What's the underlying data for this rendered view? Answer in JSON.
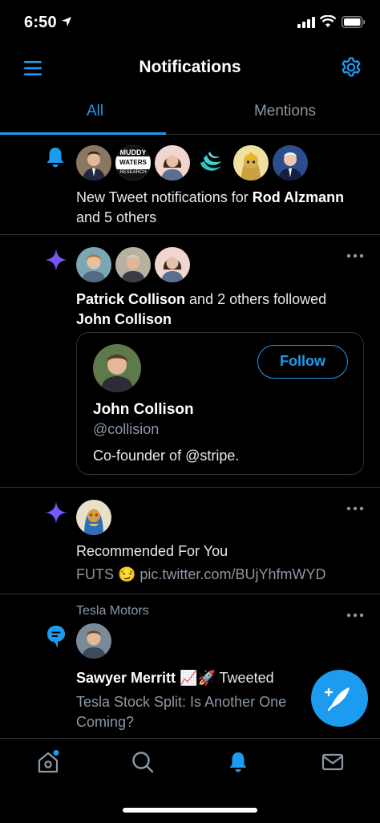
{
  "status_bar": {
    "time": "6:50"
  },
  "header": {
    "title": "Notifications"
  },
  "tabs": [
    {
      "label": "All"
    },
    {
      "label": "Mentions"
    }
  ],
  "colors": {
    "accent": "#1d9bf0",
    "purple": "#7856ff",
    "background": "#000000",
    "divider": "#2f3336",
    "muted": "#8b98a5"
  },
  "notifications": [
    {
      "icon": "bell-icon",
      "avatar_labels": {
        "muddy_line1": "MUDDY",
        "muddy_line2": "WATERS",
        "muddy_line3": "RESEARCH"
      },
      "text_prefix": "New Tweet notifications for ",
      "text_bold": "Rod Alzmann",
      "text_suffix": " and 5 others"
    },
    {
      "icon": "sparkle-icon",
      "text_bold_1": "Patrick Collison",
      "text_mid": " and 2 others followed ",
      "text_bold_2": "John Collison",
      "card": {
        "name": "John Collison",
        "handle": "@collision",
        "bio": "Co-founder of @stripe.",
        "follow_label": "Follow"
      }
    },
    {
      "icon": "sparkle-icon",
      "text": "Recommended For You",
      "sub": "FUTS 😏 pic.twitter.com/BUjYhfmWYD"
    },
    {
      "icon": "speech-bubble-icon",
      "context": "Tesla Motors",
      "text_bold": "Sawyer Merritt 📈🚀",
      "text_suffix": " Tweeted",
      "sub": "Tesla Stock Split: Is Another One Coming?"
    }
  ],
  "tab_bar": [
    {
      "icon": "home-icon",
      "has_dot": true
    },
    {
      "icon": "search-icon"
    },
    {
      "icon": "bell-icon",
      "active": true
    },
    {
      "icon": "mail-icon"
    }
  ]
}
